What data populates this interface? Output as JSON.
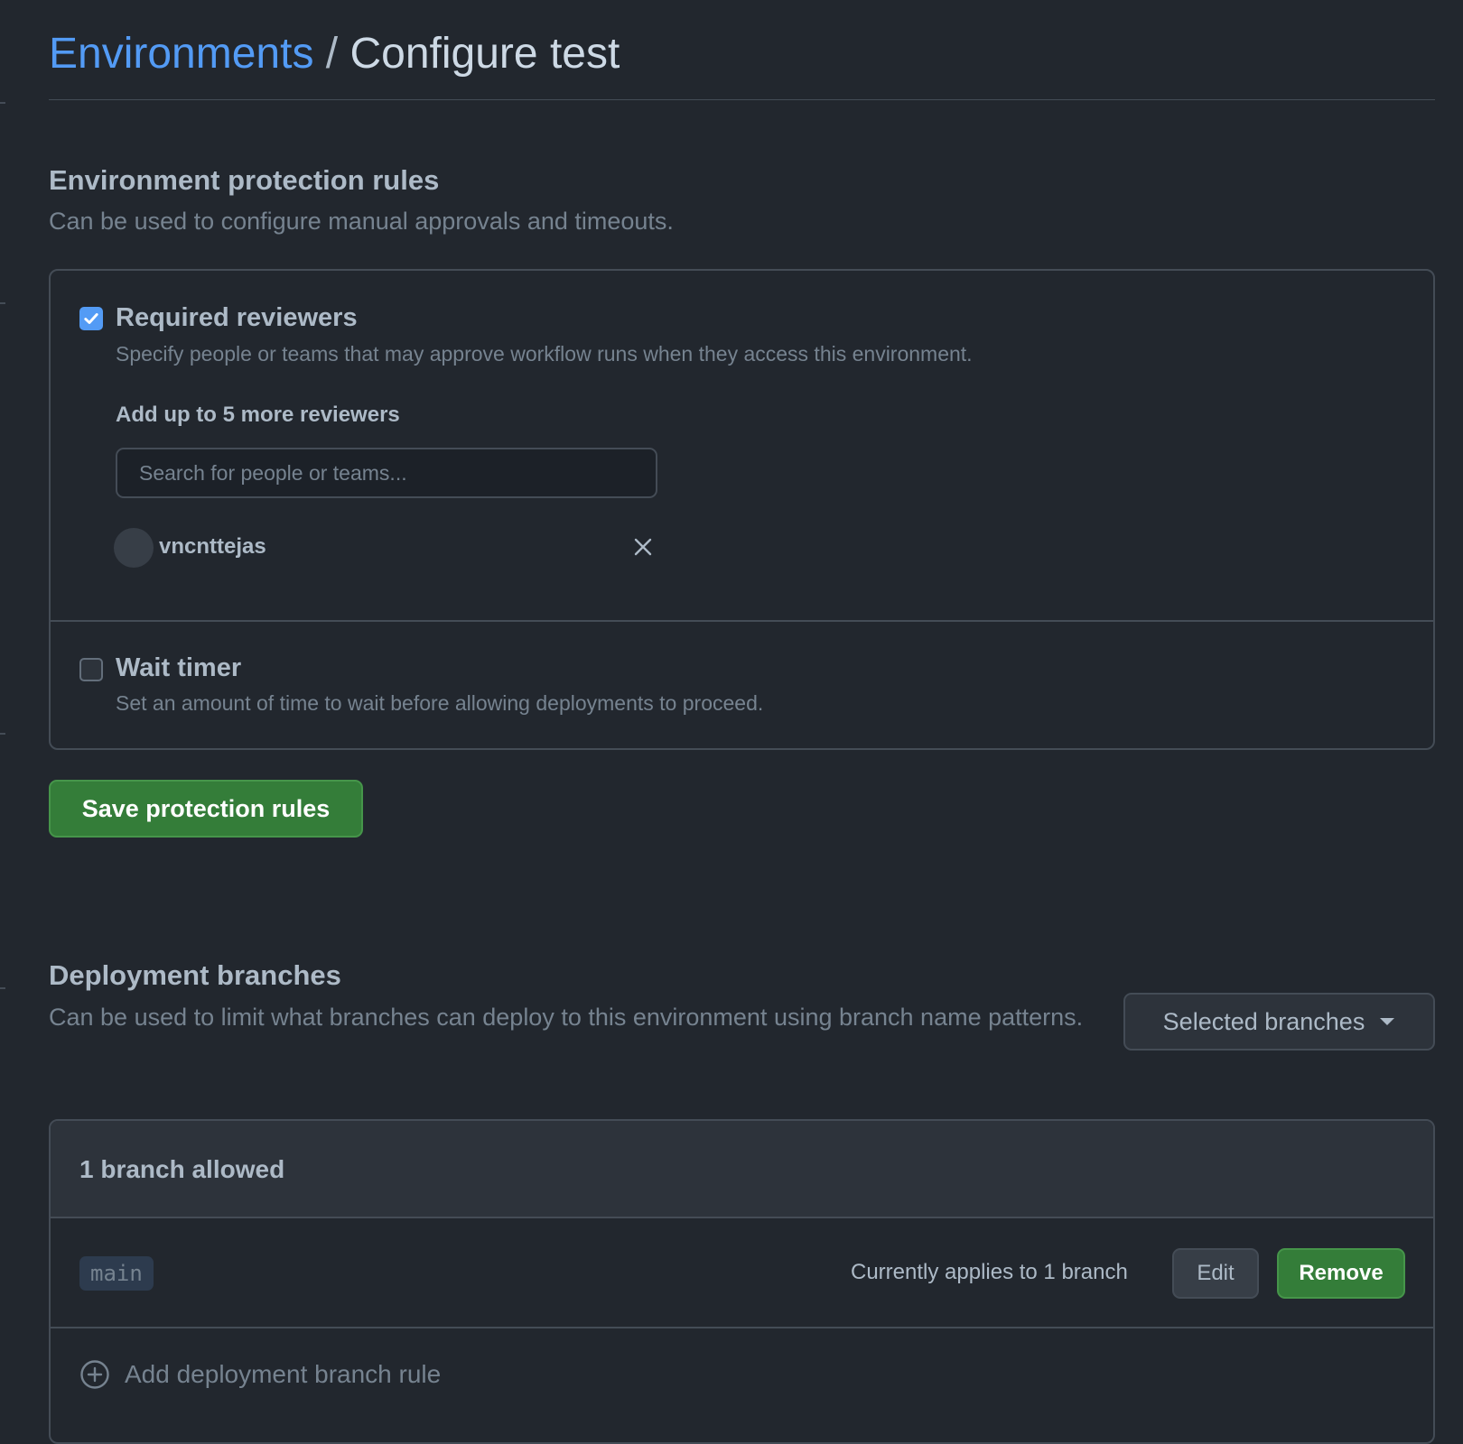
{
  "breadcrumb": {
    "parent": "Environments",
    "separator": " / ",
    "current": "Configure test"
  },
  "protection": {
    "title": "Environment protection rules",
    "description": "Can be used to configure manual approvals and timeouts.",
    "required_reviewers": {
      "checked": true,
      "label": "Required reviewers",
      "description": "Specify people or teams that may approve workflow runs when they access this environment.",
      "field_label": "Add up to 5 more reviewers",
      "search_placeholder": "Search for people or teams...",
      "search_value": "",
      "reviewers": [
        {
          "name": "vncnttejas"
        }
      ]
    },
    "wait_timer": {
      "checked": false,
      "label": "Wait timer",
      "description": "Set an amount of time to wait before allowing deployments to proceed."
    },
    "save_label": "Save protection rules"
  },
  "deployment": {
    "title": "Deployment branches",
    "description": "Can be used to limit what branches can deploy to this environment using branch name patterns.",
    "selector_label": "Selected branches",
    "allowed_count_label": "1 branch allowed",
    "branches": [
      {
        "pattern": "main",
        "applies_text": "Currently applies to 1 branch",
        "edit_label": "Edit",
        "remove_label": "Remove"
      }
    ],
    "add_rule_label": "Add deployment branch rule"
  },
  "colors": {
    "background": "#22272e",
    "link": "#539bf5",
    "primary_button": "#347d39",
    "border": "#444c56",
    "muted_text": "#768390"
  },
  "icons": {
    "checkbox_checked": "check-icon",
    "remove_reviewer": "close-icon",
    "dropdown": "triangle-down-icon",
    "add_rule": "plus-circle-icon"
  }
}
